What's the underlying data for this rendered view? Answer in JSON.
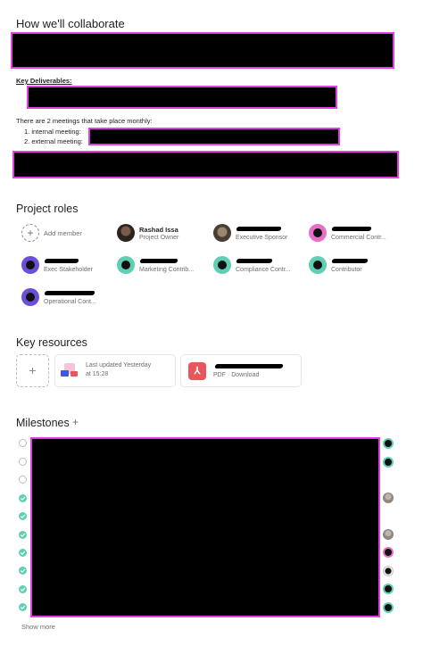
{
  "collab": {
    "title": "How we'll collaborate",
    "key_deliverables": "Key Deliverables:",
    "meetings_text": "There are 2 meetings that take place monthly:",
    "meeting_1": "1.  internal meeting:",
    "meeting_2": "2.  external meeting:"
  },
  "roles": {
    "title": "Project roles",
    "add_member": "Add member",
    "members": [
      {
        "name": "Rashad Issa",
        "role": "Project Owner"
      },
      {
        "name": "",
        "role": "Executive Sponsor"
      },
      {
        "name": "",
        "role": "Commercial Contr..."
      },
      {
        "name": "",
        "role": "Exec Stakeholder"
      },
      {
        "name": "",
        "role": "Marketing Contrib..."
      },
      {
        "name": "",
        "role": "Compliance Contr..."
      },
      {
        "name": "",
        "role": "Contributor"
      },
      {
        "name": "",
        "role": "Operational Cont..."
      }
    ]
  },
  "resources": {
    "title": "Key resources",
    "add_symbol": "+",
    "items": [
      {
        "line1": "Last updated Yesterday",
        "line2": "at 15:28",
        "icon": "document-thumbnail-icon"
      },
      {
        "line1": "",
        "line2": "PDF · Download",
        "icon": "pdf-icon"
      }
    ]
  },
  "milestones": {
    "title": "Milestones",
    "add_symbol": "+",
    "show_more": "Show more",
    "rows": [
      {
        "status": "open"
      },
      {
        "status": "open"
      },
      {
        "status": "open"
      },
      {
        "status": "done"
      },
      {
        "status": "done"
      },
      {
        "status": "done"
      },
      {
        "status": "done"
      },
      {
        "status": "done"
      },
      {
        "status": "done"
      },
      {
        "status": "done"
      }
    ]
  },
  "colors": {
    "redaction_border": "#e040e0",
    "teal": "#5fcfb4",
    "purple": "#6b4fd8",
    "pdf_red": "#e8555b"
  }
}
